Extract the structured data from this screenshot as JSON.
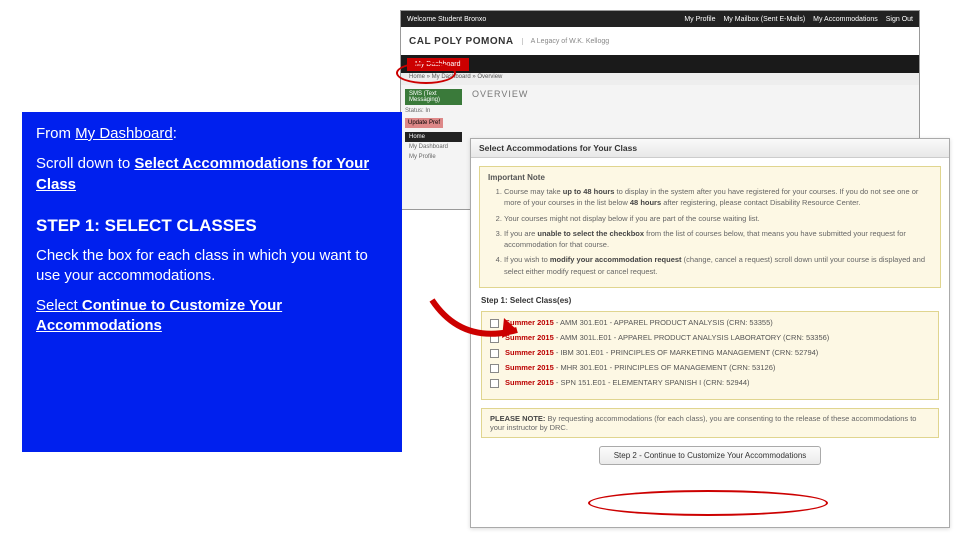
{
  "instructions": {
    "line1a": "From ",
    "line1b": "My Dashboard",
    "line1c": ":",
    "line2a": "Scroll down to ",
    "line2b": "Select Accommodations for Your Class",
    "step_heading": "STEP 1: SELECT CLASSES",
    "line3": "Check the box for each class in which you want to use your accommodations.",
    "line4a": "Select ",
    "line4b": "Continue to Customize Your Accommodations"
  },
  "bg": {
    "welcome": "Welcome Student Bronxo",
    "nav": {
      "profile": "My Profile",
      "mailbox": "My Mailbox (Sent E-Mails)",
      "accom": "My Accommodations",
      "signout": "Sign Out"
    },
    "logo": "CAL POLY POMONA",
    "legacy": "A Legacy of W.K. Kellogg",
    "tab": "My Dashboard",
    "breadcrumb": "Home  »  My Dashboard  »  Overview",
    "sms": "SMS (Text Messaging)",
    "status": "Status: In",
    "update_btn": "Update Pref",
    "home": "Home",
    "side1": "My Dashboard",
    "side2": "My Profile",
    "overview": "OVERVIEW"
  },
  "fg": {
    "title": "Select Accommodations for Your Class",
    "note_title": "Important Note",
    "notes": {
      "n1a": "Course may take ",
      "n1b": "up to 48 hours",
      "n1c": " to display in the system after you have registered for your courses. If you do not see one or more of your courses in the list below ",
      "n1d": "48 hours",
      "n1e": " after registering, please contact Disability Resource Center.",
      "n2": "Your courses might not display below if you are part of the course waiting list.",
      "n3a": "If you are ",
      "n3b": "unable to select the checkbox",
      "n3c": " from the list of courses below, that means you have submitted your request for accommodation for that course.",
      "n4a": "If you wish to ",
      "n4b": "modify your accommodation request",
      "n4c": " (change, cancel a request) scroll down until your course is displayed and select either modify request or cancel request."
    },
    "step1": "Step 1: Select Class(es)",
    "term": "Summer 2015",
    "classes": {
      "c1": " - AMM 301.E01 - APPAREL PRODUCT ANALYSIS (CRN: 53355)",
      "c2": " - AMM 301L.E01 - APPAREL PRODUCT ANALYSIS LABORATORY (CRN: 53356)",
      "c3": " - IBM 301.E01 - PRINCIPLES OF MARKETING MANAGEMENT (CRN: 52794)",
      "c4": " - MHR 301.E01 - PRINCIPLES OF MANAGEMENT (CRN: 53126)",
      "c5": " - SPN 151.E01 - ELEMENTARY SPANISH I (CRN: 52944)"
    },
    "please_b": "PLEASE NOTE:",
    "please": " By requesting accommodations (for each class), you are consenting to the release of these accommodations to your instructor by DRC.",
    "button": "Step 2 - Continue to Customize Your Accommodations"
  }
}
